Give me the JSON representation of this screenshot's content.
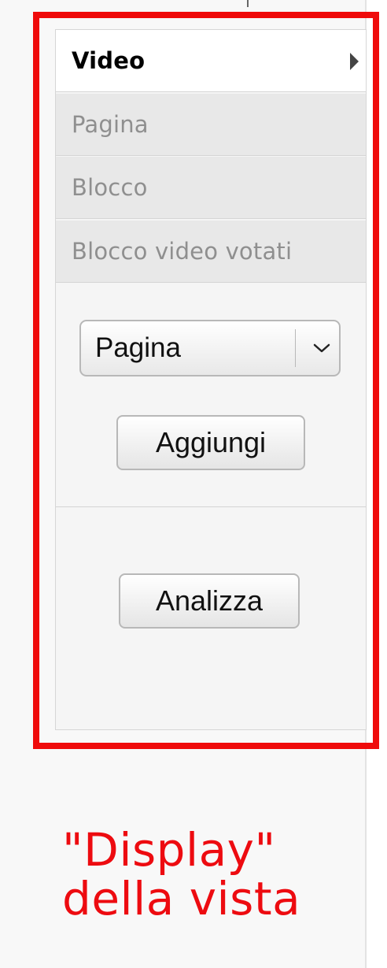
{
  "panel": {
    "tabs": [
      {
        "label": "Video",
        "active": true
      },
      {
        "label": "Pagina",
        "active": false
      },
      {
        "label": "Blocco",
        "active": false
      },
      {
        "label": "Blocco video votati",
        "active": false
      }
    ],
    "display_select": {
      "selected": "Pagina"
    },
    "add_button": "Aggiungi",
    "analyze_button": "Analizza"
  },
  "caption": {
    "line1": "\"Display\"",
    "line2": "della vista"
  },
  "colors": {
    "highlight": "#ef0b0b",
    "caption_text": "#ed0b10"
  },
  "icons": {
    "tab_arrow": "triangle-right-icon",
    "select_arrow": "chevron-down-icon"
  }
}
